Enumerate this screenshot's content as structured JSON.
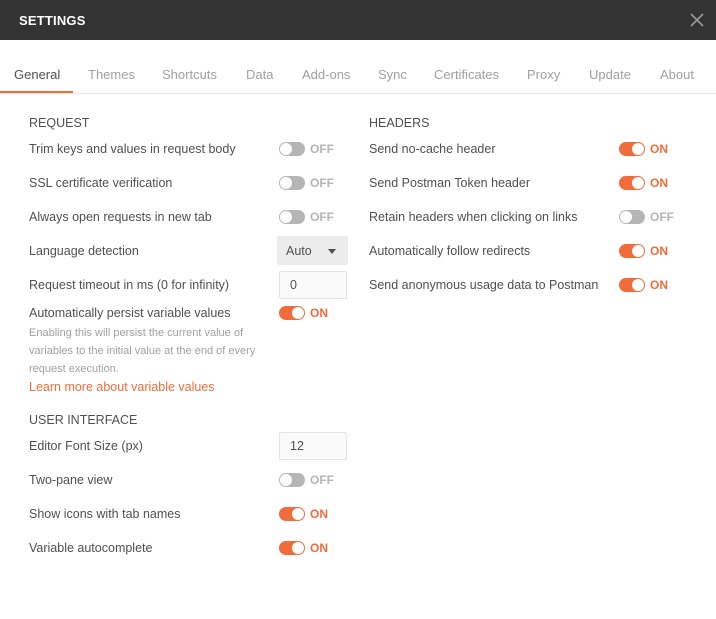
{
  "window": {
    "title": "SETTINGS",
    "close_icon": "close-icon"
  },
  "tabs": [
    {
      "label": "General",
      "active": true
    },
    {
      "label": "Themes"
    },
    {
      "label": "Shortcuts"
    },
    {
      "label": "Data"
    },
    {
      "label": "Add-ons"
    },
    {
      "label": "Sync"
    },
    {
      "label": "Certificates"
    },
    {
      "label": "Proxy"
    },
    {
      "label": "Update"
    },
    {
      "label": "About"
    }
  ],
  "request": {
    "heading": "REQUEST",
    "trim_keys": {
      "label": "Trim keys and values in request body",
      "state": "OFF"
    },
    "ssl": {
      "label": "SSL certificate verification",
      "state": "OFF"
    },
    "new_tab": {
      "label": "Always open requests in new tab",
      "state": "OFF"
    },
    "language": {
      "label": "Language detection",
      "value": "Auto"
    },
    "timeout": {
      "label": "Request timeout in ms (0 for infinity)",
      "value": "0"
    },
    "persist": {
      "label": "Automatically persist variable values",
      "state": "ON",
      "help": "Enabling this will persist the current value of variables to the initial value at the end of every request execution.",
      "link": "Learn more about variable values"
    }
  },
  "ui": {
    "heading": "USER INTERFACE",
    "font_size": {
      "label": "Editor Font Size (px)",
      "value": "12"
    },
    "two_pane": {
      "label": "Two-pane view",
      "state": "OFF"
    },
    "icons_tabs": {
      "label": "Show icons with tab names",
      "state": "ON"
    },
    "autocomplete": {
      "label": "Variable autocomplete",
      "state": "ON"
    }
  },
  "headers": {
    "heading": "HEADERS",
    "no_cache": {
      "label": "Send no-cache header",
      "state": "ON"
    },
    "postman_token": {
      "label": "Send Postman Token header",
      "state": "ON"
    },
    "retain": {
      "label": "Retain headers when clicking on links",
      "state": "OFF"
    },
    "redirects": {
      "label": "Automatically follow redirects",
      "state": "ON"
    },
    "usage": {
      "label": "Send anonymous usage data to Postman",
      "state": "ON"
    }
  },
  "colors": {
    "accent": "#f26b3a",
    "titlebar": "#333333",
    "toggle_off": "#b5b5b5"
  }
}
